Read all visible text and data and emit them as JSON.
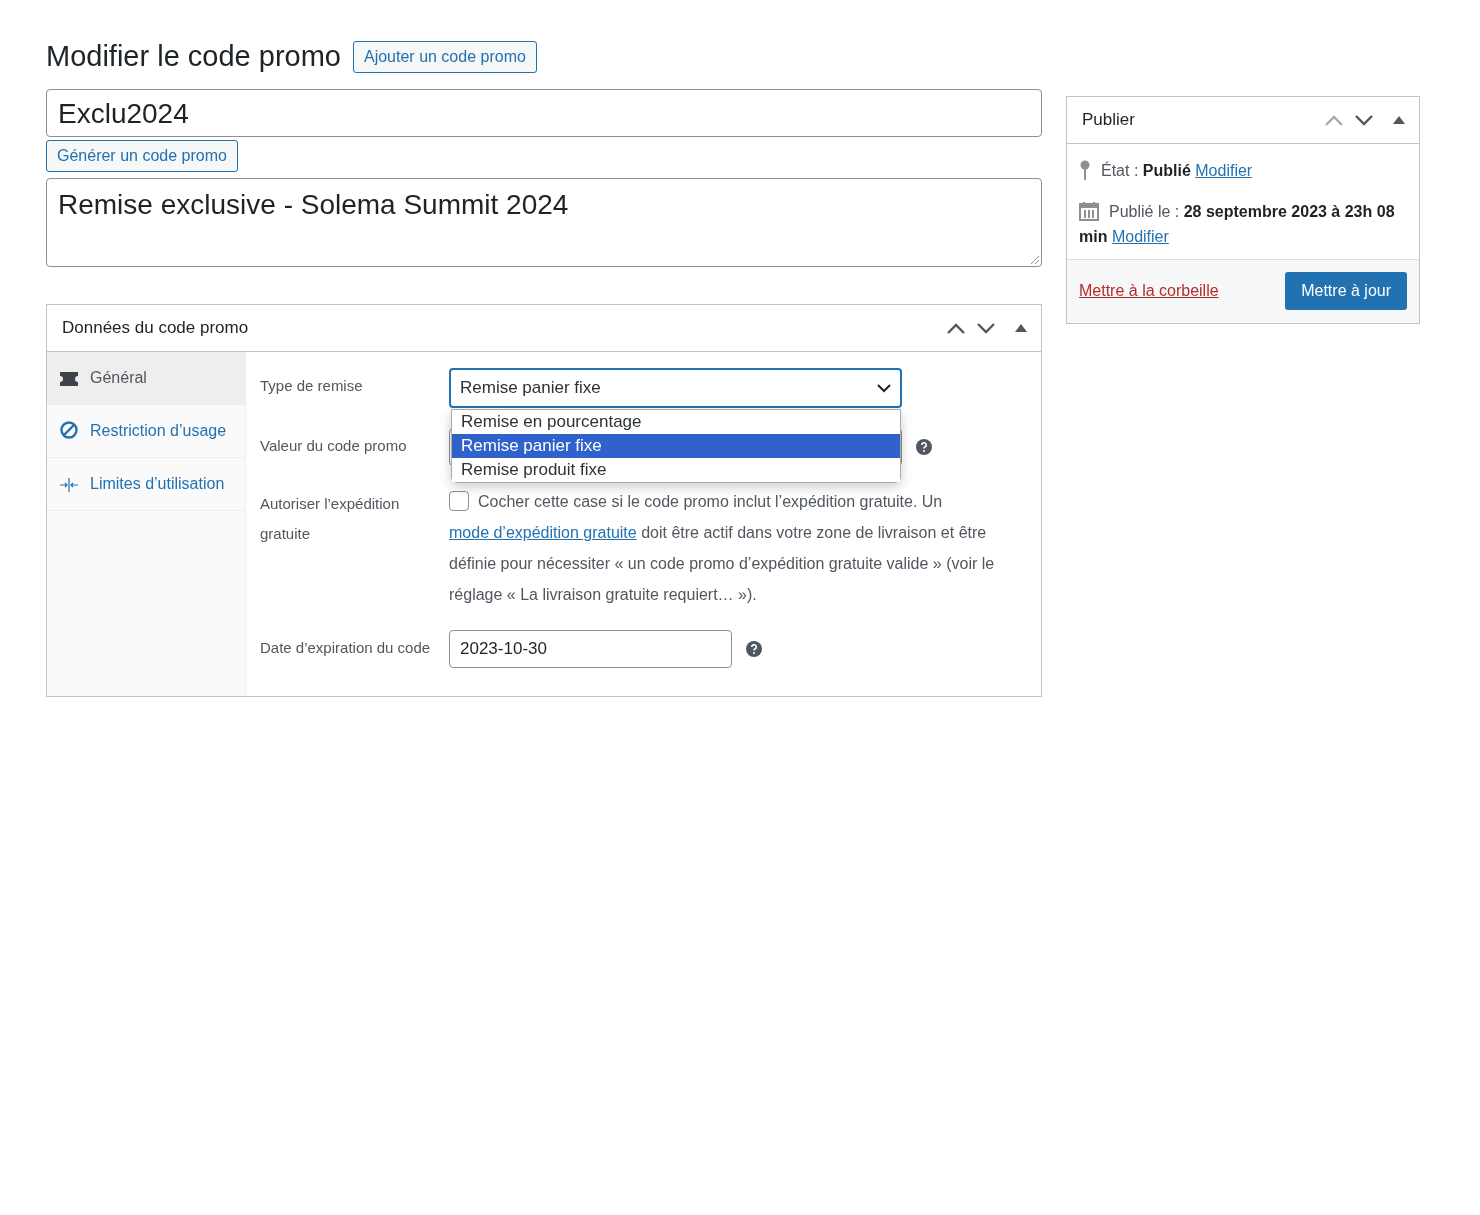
{
  "header": {
    "title": "Modifier le code promo",
    "add_button": "Ajouter un code promo"
  },
  "code_field": {
    "value": "Exclu2024"
  },
  "generate_button": "Générer un code promo",
  "description_field": {
    "value": "Remise exclusive - Solema Summit 2024"
  },
  "coupon_data": {
    "title": "Données du code promo",
    "tabs": [
      {
        "label": "Général",
        "selected": true
      },
      {
        "label": "Restriction d’usage",
        "selected": false
      },
      {
        "label": "Limites d’utilisation",
        "selected": false
      }
    ],
    "fields": [
      {
        "kind": "select",
        "label": "Type de remise",
        "value": "Remise panier fixe",
        "options": [
          {
            "label": "Remise en pourcentage",
            "selected": false
          },
          {
            "label": "Remise panier fixe",
            "selected": true
          },
          {
            "label": "Remise produit fixe",
            "selected": false
          }
        ]
      },
      {
        "kind": "input",
        "label": "Valeur du code promo"
      },
      {
        "kind": "checkbox",
        "label": "Autoriser l’expédition gratuite",
        "checked": false,
        "text_before": "Cocher cette case si le code promo inclut l’expédition gratuite. Un ",
        "link": "mode d’expédition gratuite",
        "text_after": " doit être actif dans votre zone de livraison et être définie pour nécessiter « un code promo d’expédition gratuite valide » (voir le réglage « La livraison gratuite requiert… »)."
      },
      {
        "kind": "date",
        "label": "Date d’expiration du code",
        "value": "2023-10-30"
      }
    ]
  },
  "publish": {
    "title": "Publier",
    "status": "État : **Publié**",
    "status_link": "Modifier",
    "date": "Publié le : **28 septembre 2023 à 23h 08 min**",
    "date_link": "Modifier",
    "trash_link": "Mettre à la corbeille",
    "update_button": "Mettre à jour"
  }
}
